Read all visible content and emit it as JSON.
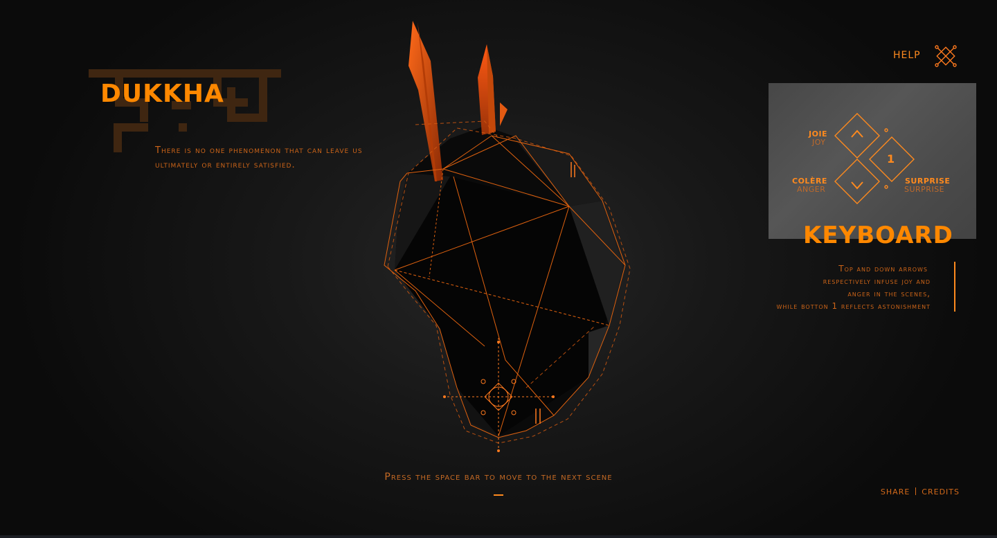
{
  "scene": {
    "title": "DUKKHA",
    "devanagari_title": "दुःख",
    "subtitle": "There is no one phenomenon that can leave us ultimately or entirely satisfied."
  },
  "help": {
    "label": "HELP",
    "icon": "close-x-icon"
  },
  "keyboard": {
    "title": "KEYBOARD",
    "keys": {
      "up": {
        "label": "JOIE",
        "sublabel": "JOY",
        "icon": "chevron-up-icon"
      },
      "down": {
        "label": "COLÈRE",
        "sublabel": "ANGER",
        "icon": "chevron-down-icon"
      },
      "one": {
        "label": "SURPRISE",
        "sublabel": "SURPRISE",
        "key": "1"
      }
    },
    "description": [
      "Top and down arrows",
      "respectively infuse joy and",
      "anger in the scenes,",
      "while botton 1 reflects astonishment"
    ]
  },
  "prompt": "Press the space bar to move to the next scene",
  "footer": {
    "share": "SHARE",
    "credits": "CREDITS"
  },
  "colors": {
    "accent": "#ff8800",
    "muted_orange": "#cc6418",
    "devanagari_brown": "#3f2611",
    "background": "#121212",
    "panel_gray": "#505050"
  }
}
